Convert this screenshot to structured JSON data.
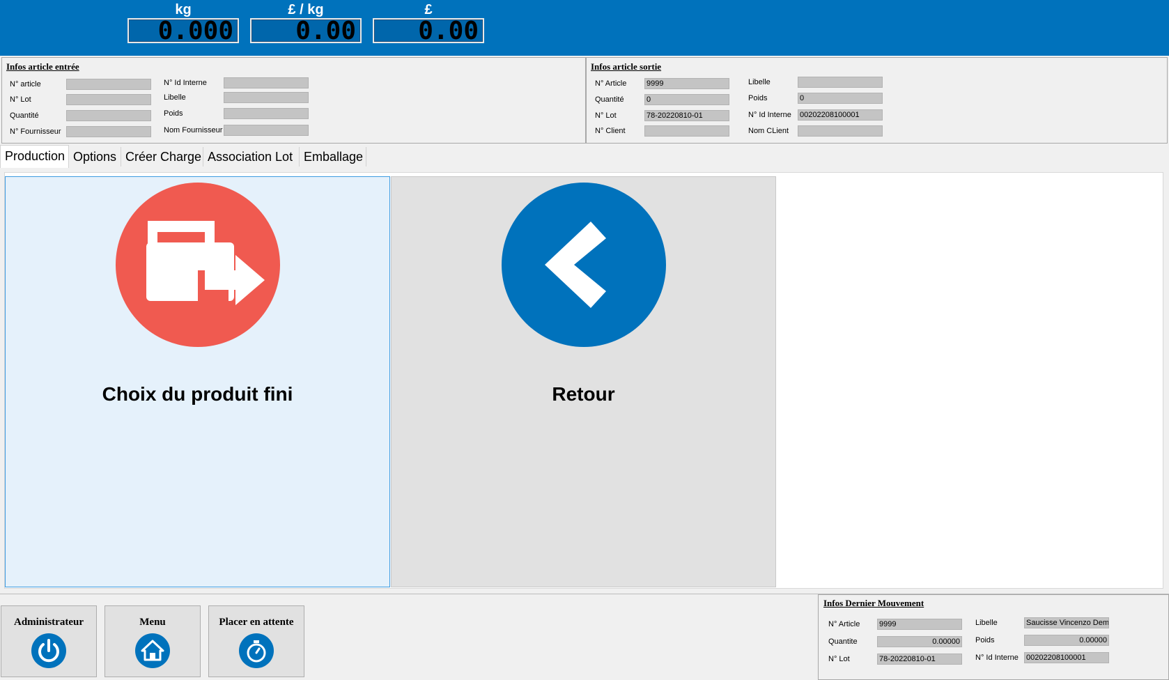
{
  "scale": [
    {
      "unit": "kg",
      "value": "0.000"
    },
    {
      "unit": "£ / kg",
      "value": "0.00"
    },
    {
      "unit": "£",
      "value": "0.00"
    }
  ],
  "infos_entree": {
    "title": "Infos article entrée",
    "left_fields": [
      {
        "label": "N° article",
        "value": ""
      },
      {
        "label": "N° Lot",
        "value": ""
      },
      {
        "label": "Quantité",
        "value": ""
      },
      {
        "label": "N° Fournisseur",
        "value": ""
      }
    ],
    "right_fields": [
      {
        "label": "N° Id Interne",
        "value": ""
      },
      {
        "label": "Libelle",
        "value": ""
      },
      {
        "label": "Poids",
        "value": ""
      },
      {
        "label": "Nom Fournisseur",
        "value": ""
      }
    ]
  },
  "infos_sortie": {
    "title": "Infos article sortie",
    "left_fields": [
      {
        "label": "N° Article",
        "value": "9999"
      },
      {
        "label": "Quantité",
        "value": "0"
      },
      {
        "label": "N° Lot",
        "value": "78-20220810-01"
      },
      {
        "label": "N° Client",
        "value": ""
      }
    ],
    "right_fields": [
      {
        "label": "Libelle",
        "value": ""
      },
      {
        "label": "Poids",
        "value": "0"
      },
      {
        "label": "N° Id Interne",
        "value": "00202208100001"
      },
      {
        "label": "Nom CLient",
        "value": ""
      }
    ]
  },
  "tabs": [
    {
      "label": "Production",
      "active": true
    },
    {
      "label": "Options",
      "active": false
    },
    {
      "label": "Créer Charge",
      "active": false
    },
    {
      "label": "Association Lot",
      "active": false
    },
    {
      "label": "Emballage",
      "active": false
    }
  ],
  "actions": {
    "choix": {
      "label": "Choix du produit fini",
      "icon": "exit-bag-icon",
      "color": "#f05a50"
    },
    "retour": {
      "label": "Retour",
      "icon": "chevron-left-icon",
      "color": "#0072bc"
    }
  },
  "nav": [
    {
      "label": "Administrateur",
      "icon": "power-icon"
    },
    {
      "label": "Menu",
      "icon": "home-icon"
    },
    {
      "label": "Placer en attente",
      "icon": "stopwatch-icon"
    }
  ],
  "dernier_mouvement": {
    "title": "Infos Dernier Mouvement",
    "left_fields": [
      {
        "label": "N° Article",
        "value": "9999"
      },
      {
        "label": "Quantite",
        "value": "0.00000"
      },
      {
        "label": "N° Lot",
        "value": "78-20220810-01"
      }
    ],
    "right_fields": [
      {
        "label": "Libelle",
        "value": "Saucisse Vincenzo Demo"
      },
      {
        "label": "Poids",
        "value": "0.00000"
      },
      {
        "label": "N° Id Interne",
        "value": "00202208100001"
      }
    ]
  },
  "colors": {
    "accent": "#0072bc",
    "danger": "#f05a50",
    "field_bg": "#c4c4c4"
  }
}
